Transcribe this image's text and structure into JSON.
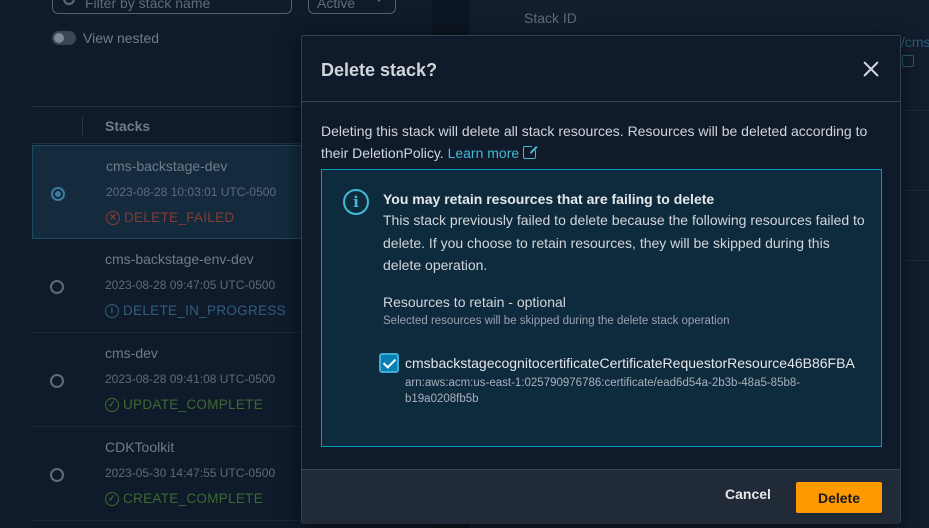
{
  "background": {
    "filter_placeholder": "Filter by stack name",
    "status_filter": "Active",
    "view_nested_label": "View nested",
    "table_header": "Stacks",
    "rows": [
      {
        "name": "cms-backstage-dev",
        "time": "2023-08-28 10:03:01 UTC-0500",
        "status": "DELETE_FAILED",
        "selected": true
      },
      {
        "name": "cms-backstage-env-dev",
        "time": "2023-08-28 09:47:05 UTC-0500",
        "status": "DELETE_IN_PROGRESS",
        "selected": false
      },
      {
        "name": "cms-dev",
        "time": "2023-08-28 09:41:08 UTC-0500",
        "status": "UPDATE_COMPLETE",
        "selected": false
      },
      {
        "name": "CDKToolkit",
        "time": "2023-05-30 14:47:55 UTC-0500",
        "status": "CREATE_COMPLETE",
        "selected": false
      }
    ],
    "detail_label": "Stack ID",
    "detail_link_fragment": "/cms"
  },
  "modal": {
    "title": "Delete stack?",
    "description": "Deleting this stack will delete all stack resources. Resources will be deleted according to their DeletionPolicy.",
    "learn_more": "Learn more",
    "alert": {
      "title": "You may retain resources that are failing to delete",
      "text": "This stack previously failed to delete because the following resources failed to delete. If you choose to retain resources, they will be skipped during this delete operation.",
      "field_label": "Resources to retain - optional",
      "field_description": "Selected resources will be skipped during the delete stack operation",
      "resource": {
        "name": "cmsbackstagecognitocertificateCertificateRequestorResource46B86FBA",
        "arn": "arn:aws:acm:us-east-1:025790976786:certificate/ead6d54a-2b3b-48a5-85b8-b19a0208fb5b",
        "checked": true
      }
    },
    "cancel_label": "Cancel",
    "delete_label": "Delete"
  },
  "colors": {
    "accent": "#44b9d6",
    "primary_button": "#ff9900",
    "alert_border": "#0a98c4",
    "failed": "#8a3a35",
    "in_progress": "#2f5f7d",
    "complete": "#3c6a33"
  }
}
